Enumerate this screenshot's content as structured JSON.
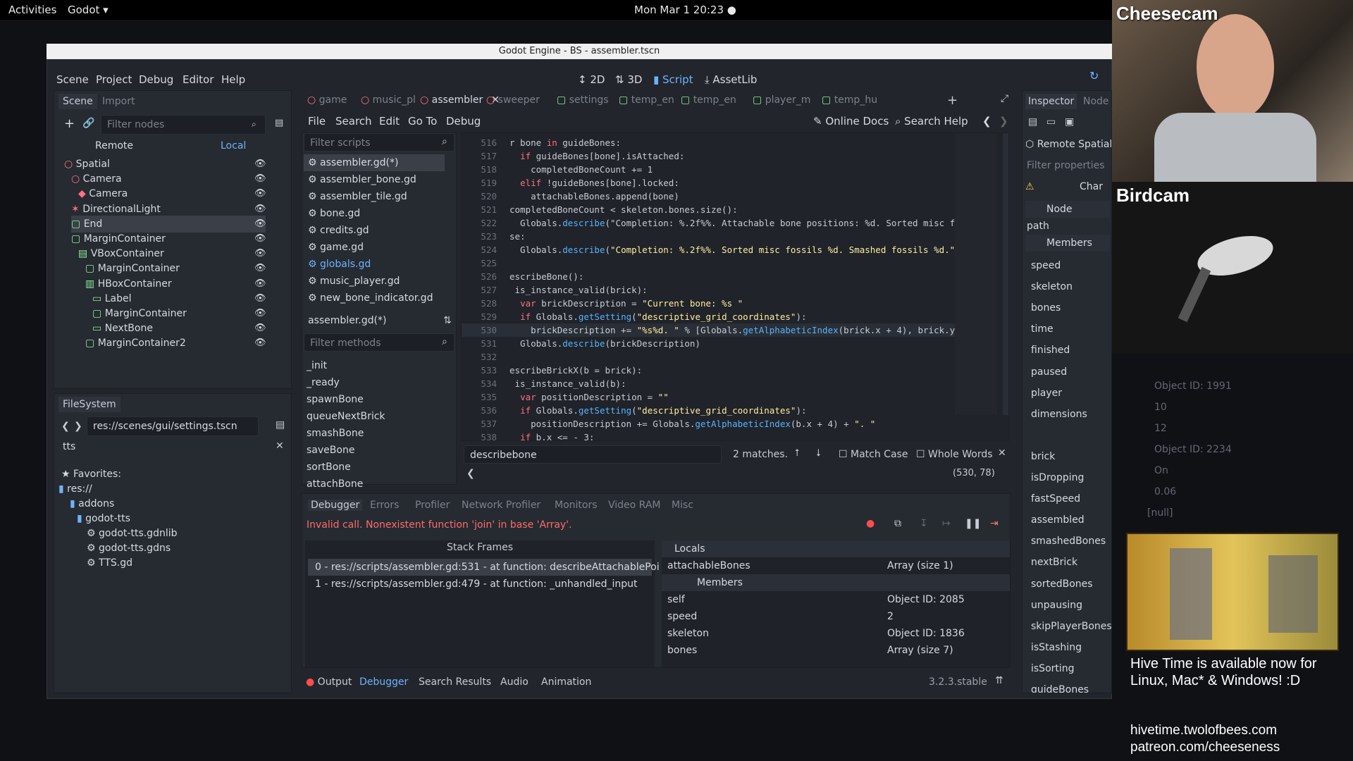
{
  "topbar": {
    "activities": "Activities",
    "app": "Godot ▾",
    "clock": "Mon Mar 1  20:23 ●"
  },
  "window": {
    "title": "Godot Engine - BS - assembler.tscn"
  },
  "menus": [
    "Scene",
    "Project",
    "Debug",
    "Editor",
    "Help"
  ],
  "workspaces": [
    "2D",
    "3D",
    "Script",
    "AssetLib"
  ],
  "scene_dock": {
    "tabs": [
      "Scene",
      "Import"
    ],
    "filter_placeholder": "Filter nodes",
    "remote": "Remote",
    "local": "Local",
    "nodes": [
      "Spatial",
      "Camera",
      "Camera",
      "DirectionalLight",
      "End",
      "MarginContainer",
      "VBoxContainer",
      "MarginContainer",
      "HBoxContainer",
      "Label",
      "MarginContainer",
      "NextBone",
      "MarginContainer2"
    ]
  },
  "filesystem": {
    "title": "FileSystem",
    "path": "res://scenes/gui/settings.tscn",
    "search": "tts",
    "items": [
      "Favorites:",
      "res://",
      "addons",
      "godot-tts",
      "godot-tts.gdnlib",
      "godot-tts.gdns",
      "TTS.gd"
    ]
  },
  "script_tabs": [
    "game",
    "music_pl",
    "assembler",
    "sweeper",
    "settings",
    "temp_en",
    "temp_en",
    "player_m",
    "temp_hu"
  ],
  "script_menus": [
    "File",
    "Search",
    "Edit",
    "Go To",
    "Debug"
  ],
  "online_docs": "Online Docs",
  "search_help": "Search Help",
  "scripts_filter": "Filter scripts",
  "scripts": [
    "assembler.gd(*)",
    "assembler_bone.gd",
    "assembler_tile.gd",
    "bone.gd",
    "credits.gd",
    "game.gd",
    "globals.gd",
    "music_player.gd",
    "new_bone_indicator.gd"
  ],
  "current_script": "assembler.gd(*)",
  "methods_filter": "Filter methods",
  "methods": [
    "_init",
    "_ready",
    "spawnBone",
    "queueNextBrick",
    "smashBone",
    "saveBone",
    "sortBone",
    "attachBone"
  ],
  "code": [
    {
      "n": "516",
      "t": "r bone in guideBones:"
    },
    {
      "n": "517",
      "t": "  if guideBones[bone].isAttached:"
    },
    {
      "n": "518",
      "t": "    completedBoneCount += 1"
    },
    {
      "n": "519",
      "t": "  elif !guideBones[bone].locked:"
    },
    {
      "n": "520",
      "t": "    attachableBones.append(bone)"
    },
    {
      "n": "521",
      "t": "completedBoneCount < skeleton.bones.size():"
    },
    {
      "n": "522",
      "t": "  Globals.describe(\"Completion: %.2f%%. Attachable bone positions: %d. Sorted misc foss"
    },
    {
      "n": "523",
      "t": "se:"
    },
    {
      "n": "524",
      "t": "  Globals.describe(\"Completion: %.2f%%. Sorted misc fossils %d. Smashed fossils %d.\" %"
    },
    {
      "n": "525",
      "t": ""
    },
    {
      "n": "526",
      "t": "escribeBone():"
    },
    {
      "n": "527",
      "t": " is_instance_valid(brick):"
    },
    {
      "n": "528",
      "t": "  var brickDescription = \"Current bone: %s \""
    },
    {
      "n": "529",
      "t": "  if Globals.getSetting(\"descriptive_grid_coordinates\"):"
    },
    {
      "n": "530",
      "t": "    brickDescription += \"%s%d. \" % [Globals.getAlphabeticIndex(brick.x + 4), brick.y]"
    },
    {
      "n": "531",
      "t": "  Globals.describe(brickDescription)"
    },
    {
      "n": "532",
      "t": ""
    },
    {
      "n": "533",
      "t": "escribeBrickX(b = brick):"
    },
    {
      "n": "534",
      "t": " is_instance_valid(b):"
    },
    {
      "n": "535",
      "t": "  var positionDescription = \"\""
    },
    {
      "n": "536",
      "t": "  if Globals.getSetting(\"descriptive_grid_coordinates\"):"
    },
    {
      "n": "537",
      "t": "    positionDescription += Globals.getAlphabeticIndex(b.x + 4) + \". \""
    },
    {
      "n": "538",
      "t": "  if b.x <= - 3:"
    }
  ],
  "find": {
    "query": "describebone",
    "matches": "2 matches.",
    "match_case": "Match Case",
    "whole_words": "Whole Words",
    "position": "(530, 78)"
  },
  "debugger": {
    "tabs": [
      "Debugger",
      "Errors",
      "Profiler",
      "Network Profiler",
      "Monitors",
      "Video RAM",
      "Misc"
    ],
    "error": "Invalid call. Nonexistent function 'join' in base 'Array'.",
    "stack_title": "Stack Frames",
    "frames": [
      "0 - res://scripts/assembler.gd:531 - at function: describeAttachablePoi",
      "1 - res://scripts/assembler.gd:479 - at function: _unhandled_input"
    ],
    "locals_title": "Locals",
    "members_title": "Members",
    "vars": [
      {
        "k": "attachableBones",
        "v": "Array (size 1)"
      },
      {
        "k": "self",
        "v": "Object ID: 2085"
      },
      {
        "k": "speed",
        "v": "2"
      },
      {
        "k": "skeleton",
        "v": "Object ID: 1836"
      },
      {
        "k": "bones",
        "v": "Array (size 7)"
      }
    ]
  },
  "bottom_tabs": [
    "Output",
    "Debugger",
    "Search Results",
    "Audio",
    "Animation"
  ],
  "version": "3.2.3.stable",
  "inspector": {
    "tabs": [
      "Inspector",
      "Node"
    ],
    "remote": "Remote Spatial",
    "filter": "Filter properties",
    "char": "Char",
    "node": "Node",
    "path": "path",
    "members": "Members",
    "props": [
      "speed",
      "skeleton",
      "bones",
      "time",
      "finished",
      "paused",
      "player",
      "dimensions",
      "",
      "brick",
      "isDropping",
      "fastSpeed",
      "assembled",
      "smashedBones",
      "nextBrick",
      "sortedBones",
      "unpausing",
      "skipPlayerBones",
      "isStashing",
      "isSorting",
      "guideBones"
    ]
  },
  "stream": {
    "cheesecam": "Cheesecam",
    "birdcam": "Birdcam",
    "promo": "Hive Time is available now for Linux, Mac* & Windows! :D",
    "url1": "hivetime.twolofbees.com",
    "url2": "patreon.com/cheeseness",
    "ghost": [
      "Object ID: 1991",
      "10",
      "12",
      "Object ID: 2234",
      "On",
      "0.06",
      "[null]"
    ]
  }
}
